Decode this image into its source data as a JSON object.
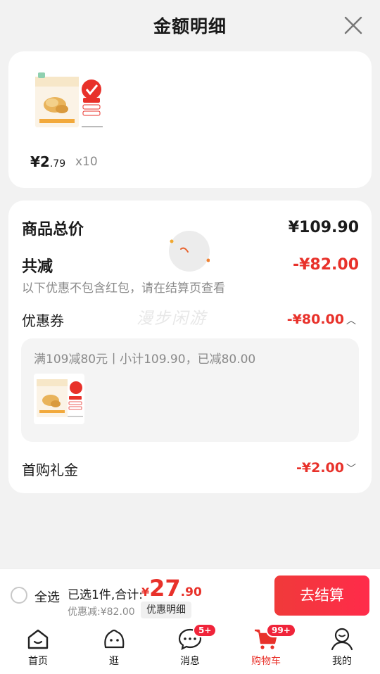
{
  "header": {
    "title": "金额明细"
  },
  "product": {
    "price_int": "¥2",
    "price_dec": ".79",
    "qty": "x10"
  },
  "summary": {
    "total_label": "商品总价",
    "total_amount": "¥109.90",
    "discount_label": "共减",
    "discount_amount": "-¥82.00",
    "discount_note": "以下优惠不包含红包，请在结算页查看",
    "coupon_label": "优惠券",
    "coupon_amount": "-¥80.00",
    "coupon_desc": "满109减80元丨小计109.90，已减80.00",
    "gift_label": "首购礼金",
    "gift_amount": "-¥2.00"
  },
  "watermark": "漫步闲游",
  "bottom_bar": {
    "select_all": "全选",
    "selected_text": "已选1件,合计:",
    "currency": "¥",
    "sum_int": "27",
    "sum_dec": ".90",
    "saved_text": "优惠减:¥82.00",
    "detail_chip": "优惠明细",
    "checkout": "去结算"
  },
  "tabs": [
    {
      "label": "首页",
      "icon": "home-icon"
    },
    {
      "label": "逛",
      "icon": "browse-face-icon"
    },
    {
      "label": "消息",
      "icon": "message-icon",
      "badge": "5+"
    },
    {
      "label": "购物车",
      "icon": "cart-icon",
      "badge": "99+",
      "active": true
    },
    {
      "label": "我的",
      "icon": "profile-icon"
    }
  ],
  "colors": {
    "accent": "#e8312a",
    "checkout": "#f03a3a",
    "background": "#f2f2f2"
  }
}
